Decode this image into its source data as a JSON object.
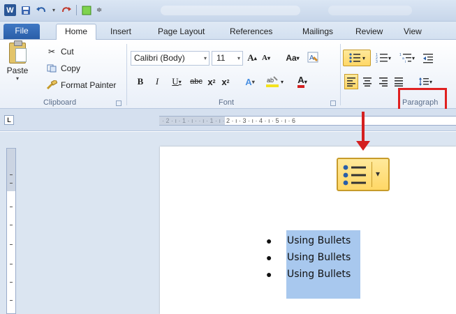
{
  "app": {
    "logo_letter": "W"
  },
  "tabs": [
    {
      "label": "File"
    },
    {
      "label": "Home"
    },
    {
      "label": "Insert"
    },
    {
      "label": "Page Layout"
    },
    {
      "label": "References"
    },
    {
      "label": "Mailings"
    },
    {
      "label": "Review"
    },
    {
      "label": "View"
    }
  ],
  "clipboard": {
    "paste_label": "Paste",
    "cut_label": "Cut",
    "copy_label": "Copy",
    "format_painter_label": "Format Painter",
    "group_label": "Clipboard"
  },
  "font": {
    "font_name": "Calibri (Body)",
    "font_size": "11",
    "group_label": "Font"
  },
  "paragraph": {
    "group_label": "Paragraph"
  },
  "ruler": {
    "text": "· 2 · ı · 1 · ı ·   · ı · 1 · ı · 2 · ı · 3 · ı · 4 · ı · 5 · ı · 6"
  },
  "document": {
    "bullets": [
      "Using Bullets",
      "Using Bullets",
      "Using Bullets"
    ]
  },
  "colors": {
    "highlight_box": "#e02020",
    "arrow": "#d42020",
    "selection": "#a8c8ee",
    "file_tab": "#2a5ea8"
  }
}
